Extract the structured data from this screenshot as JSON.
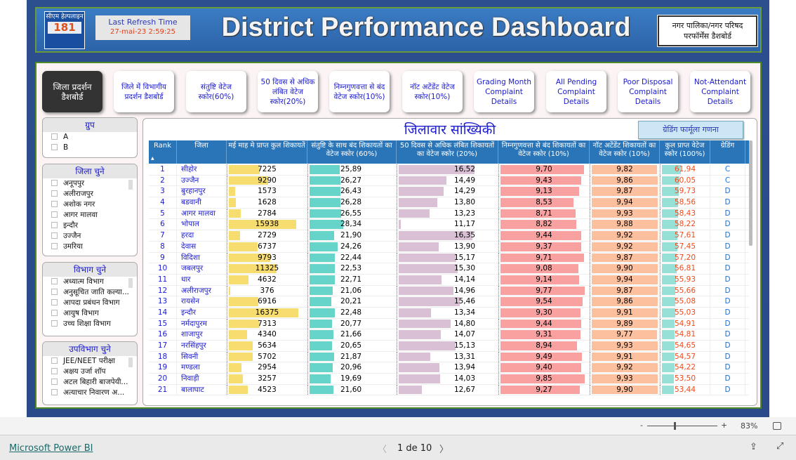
{
  "header": {
    "logo_text": "सीएम हेल्पलाइन",
    "logo_number": "181",
    "refresh_label": "Last Refresh Time",
    "refresh_value": "27-mai-23 2:59:25",
    "title": "District Performance Dashboard",
    "np_button": "नगर पालिका/नगर परिषद परफॉर्मेंस डैशबोर्ड"
  },
  "nav": [
    {
      "label": "जिला प्रदर्शन डैशबोर्ड",
      "active": true
    },
    {
      "label": "जिले में विभागीय प्रदर्शन डैशबोर्ड"
    },
    {
      "label": "संतुष्टि वेटेज स्कोर(60%)"
    },
    {
      "label": "50 दिवस से अधिक लंबित वेटेज स्कोर(20%)"
    },
    {
      "label": "निम्नगुणवत्ता से बंद वेटेज स्कोर(10%)"
    },
    {
      "label": "नॉट अटेंडेंट वेटेज स्कोर(10%)"
    },
    {
      "label": "Grading Month Complaint Details"
    },
    {
      "label": "All Pending Complaint Details"
    },
    {
      "label": "Poor Disposal Complaint Details"
    },
    {
      "label": "Not-Attendant Complaint Details"
    }
  ],
  "filters": {
    "group": {
      "title": "ग्रुप",
      "items": [
        "A",
        "B"
      ]
    },
    "district": {
      "title": "जिला चुने",
      "items": [
        "अनूपपुर",
        "अलीराजपुर",
        "अशोक नगर",
        "आगर मालवा",
        "इन्दौर",
        "उज्जैन",
        "उमरिया"
      ]
    },
    "department": {
      "title": "विभाग चुने",
      "items": [
        "अध्यात्म विभाग",
        "अनुसूचित जाति कल्या...",
        "आपदा प्रबंधन विभाग",
        "आयुष विभाग",
        "उच्च शिक्षा विभाग"
      ]
    },
    "subdepartment": {
      "title": "उपविभाग चुने",
      "items": [
        "JEE/NEET परीक्षा",
        "अक्षय उर्जा शॉप",
        "अटल बिहारी बाजपेयी...",
        "अत्याचार निवारण अ..."
      ]
    }
  },
  "table": {
    "title": "जिलावार सांख्यिकी",
    "formula_button": "ग्रेडिंग फार्मूला गणना",
    "columns": [
      "Rank",
      "जिला",
      "मई माह मे प्राप्त कुल शिकायतें",
      "संतुष्टि के साथ बंद शिकायतों का वेटेज स्कोर (60%)",
      "50 दिवस से अधिक लंबित शिकायतों का वेटेज स्कोर (20%)",
      "निम्नगुणवत्ता से बंद शिकायतों का वेटेज स्कोर (10%)",
      "नॉट अटेंडेंट शिकायतों का वेटेज स्कोर (10%)",
      "कुल प्राप्त वेटेज स्कोर (100%)",
      "ग्रेडिंग"
    ],
    "sort_icon": "triangle-up",
    "rows": [
      [
        "1",
        "सीहोर",
        "7225",
        "25,89",
        "16,52",
        "9,70",
        "9,82",
        "61,94",
        "C"
      ],
      [
        "2",
        "उज्जैन",
        "9290",
        "26,27",
        "14,49",
        "9,43",
        "9,86",
        "60,05",
        "C"
      ],
      [
        "3",
        "बुरहानपुर",
        "1573",
        "26,43",
        "14,29",
        "9,13",
        "9,87",
        "59,73",
        "D"
      ],
      [
        "4",
        "बडवानी",
        "1628",
        "26,28",
        "13,80",
        "8,53",
        "9,94",
        "58,56",
        "D"
      ],
      [
        "5",
        "आगर मालवा",
        "2784",
        "26,55",
        "13,23",
        "8,71",
        "9,93",
        "58,43",
        "D"
      ],
      [
        "6",
        "भोपाल",
        "15938",
        "28,34",
        "11,17",
        "8,82",
        "9,88",
        "58,22",
        "D"
      ],
      [
        "7",
        "हरदा",
        "2729",
        "21,90",
        "16,35",
        "9,44",
        "9,92",
        "57,61",
        "D"
      ],
      [
        "8",
        "देवास",
        "6737",
        "24,26",
        "13,90",
        "9,37",
        "9,92",
        "57,45",
        "D"
      ],
      [
        "9",
        "विदिशा",
        "9793",
        "22,44",
        "15,17",
        "9,71",
        "9,87",
        "57,20",
        "D"
      ],
      [
        "10",
        "जबलपुर",
        "11325",
        "22,53",
        "15,30",
        "9,08",
        "9,90",
        "56,81",
        "D"
      ],
      [
        "11",
        "धार",
        "4632",
        "22,71",
        "14,14",
        "9,14",
        "9,94",
        "55,93",
        "D"
      ],
      [
        "12",
        "अलीराजपुर",
        "376",
        "21,06",
        "14,96",
        "9,77",
        "9,87",
        "55,66",
        "D"
      ],
      [
        "13",
        "रायसेन",
        "6916",
        "20,21",
        "15,46",
        "9,54",
        "9,86",
        "55,08",
        "D"
      ],
      [
        "14",
        "इन्दौर",
        "16375",
        "22,48",
        "13,34",
        "9,30",
        "9,91",
        "55,03",
        "D"
      ],
      [
        "15",
        "नर्मदापुरम",
        "7313",
        "20,77",
        "14,80",
        "9,44",
        "9,89",
        "54,91",
        "D"
      ],
      [
        "16",
        "शाजापुर",
        "4340",
        "21,66",
        "14,07",
        "9,31",
        "9,77",
        "54,81",
        "D"
      ],
      [
        "17",
        "नरसिंहपुर",
        "5634",
        "20,65",
        "15,13",
        "8,94",
        "9,93",
        "54,65",
        "D"
      ],
      [
        "18",
        "सिवनी",
        "5702",
        "21,87",
        "13,31",
        "9,49",
        "9,91",
        "54,57",
        "D"
      ],
      [
        "19",
        "मण्डला",
        "2954",
        "20,96",
        "13,94",
        "9,40",
        "9,92",
        "54,22",
        "D"
      ],
      [
        "20",
        "निवाड़ी",
        "3257",
        "19,69",
        "14,03",
        "9,85",
        "9,93",
        "53,50",
        "D"
      ],
      [
        "21",
        "बालाघाट",
        "4523",
        "21,60",
        "12,67",
        "9,27",
        "9,90",
        "53,44",
        "D"
      ]
    ]
  },
  "colors": {
    "complaints": "#f7dc6f",
    "satisfaction": "#66d4c8",
    "pending50": "#d9c0d4",
    "lowquality": "#f9a0a0",
    "notattended": "#fcc09f",
    "total": "#96e0d8",
    "total_text": "#f04a1a",
    "grade_text": "#1a6fe0",
    "rank_text": "#1a1ad0"
  },
  "zoom": {
    "minus": "-",
    "plus": "+",
    "level": "83%"
  },
  "footer": {
    "brand": "Microsoft Power BI",
    "page": "1 de 10"
  }
}
